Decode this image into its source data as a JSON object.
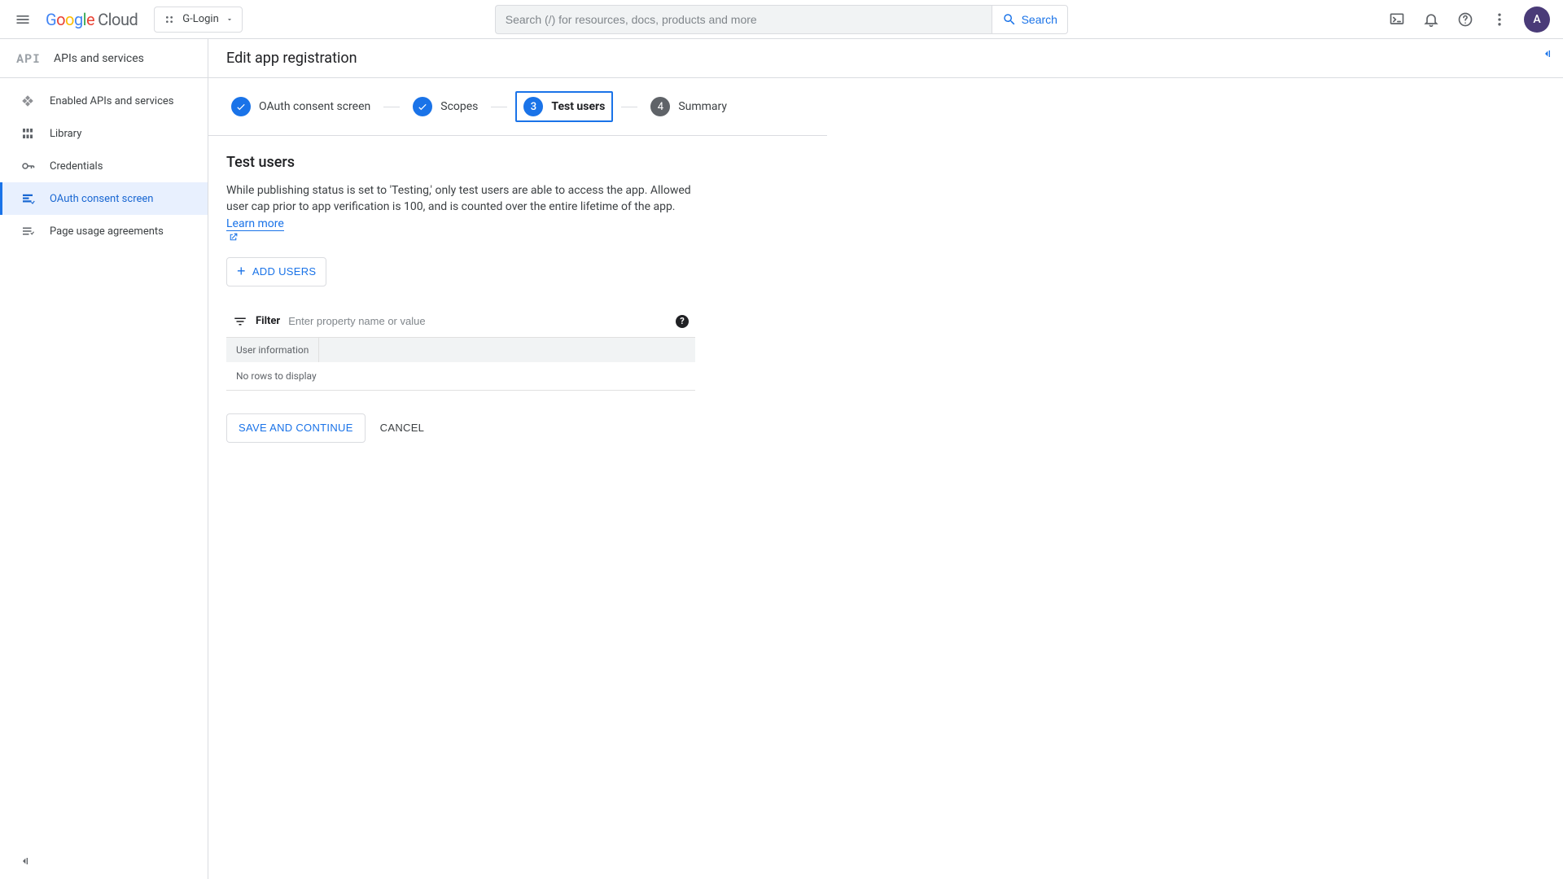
{
  "header": {
    "logo_cloud": "Cloud",
    "project_name": "G-Login",
    "search_placeholder": "Search (/) for resources, docs, products and more",
    "search_button": "Search",
    "avatar_initial": "A"
  },
  "sidebar": {
    "badge": "API",
    "title": "APIs and services",
    "items": [
      {
        "label": "Enabled APIs and services"
      },
      {
        "label": "Library"
      },
      {
        "label": "Credentials"
      },
      {
        "label": "OAuth consent screen"
      },
      {
        "label": "Page usage agreements"
      }
    ]
  },
  "page": {
    "title": "Edit app registration",
    "steps": [
      {
        "label": "OAuth consent screen",
        "state": "done"
      },
      {
        "label": "Scopes",
        "state": "done"
      },
      {
        "label": "Test users",
        "state": "current",
        "number": "3"
      },
      {
        "label": "Summary",
        "state": "future",
        "number": "4"
      }
    ],
    "section_title": "Test users",
    "description_prefix": "While publishing status is set to 'Testing,' only test users are able to access the app. Allowed user cap prior to app verification is 100, and is counted over the entire lifetime of the app. ",
    "learn_more": "Learn more",
    "add_users": "ADD USERS",
    "filter_label": "Filter",
    "filter_placeholder": "Enter property name or value",
    "table_header": "User information",
    "empty_message": "No rows to display",
    "save_label": "SAVE AND CONTINUE",
    "cancel_label": "CANCEL"
  }
}
